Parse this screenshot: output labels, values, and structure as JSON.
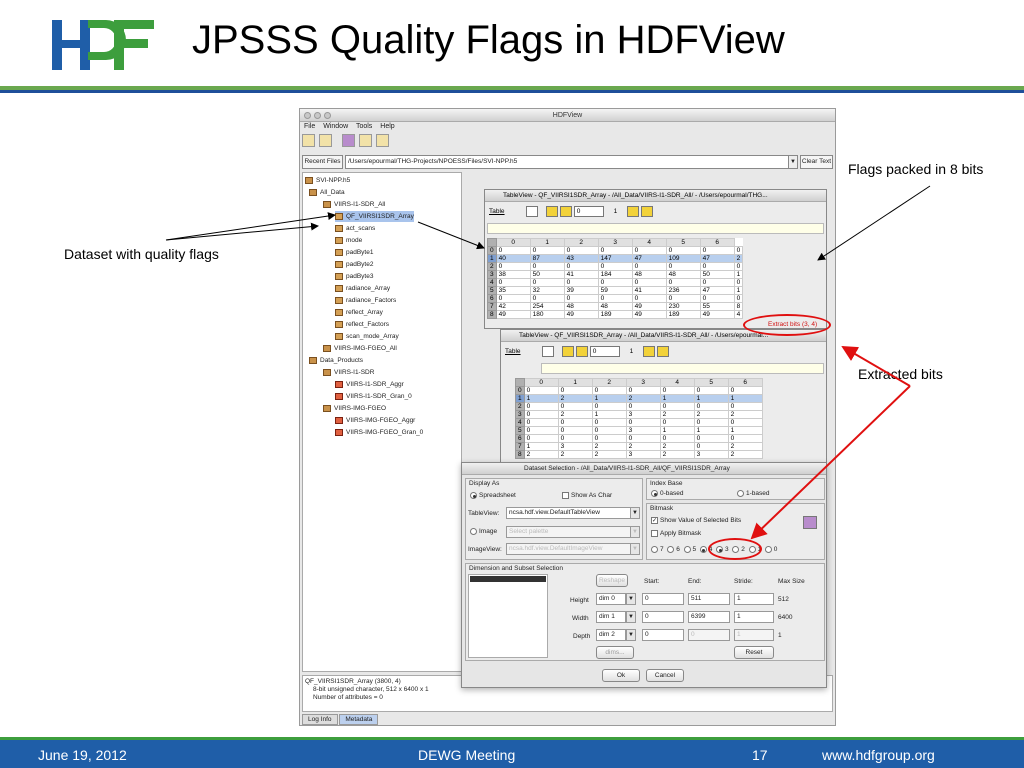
{
  "slide": {
    "title": "JPSSS Quality Flags in HDFView",
    "logo_text": "HDF",
    "callouts": {
      "flags_packed": "Flags packed in 8 bits",
      "dataset_with_flags": "Dataset with quality flags",
      "extracted_bits": "Extracted bits"
    },
    "footer": {
      "date": "June 19, 2012",
      "event": "DEWG Meeting",
      "page": "17",
      "url": "www.hdfgroup.org"
    },
    "colors": {
      "green": "#3d9e3d",
      "blue": "#1f5ea8",
      "annotation": "#e01010"
    }
  },
  "hdfview": {
    "window_title": "HDFView",
    "menu": [
      "File",
      "Window",
      "Tools",
      "Help"
    ],
    "recent_files_label": "Recent Files",
    "recent_path": "/Users/epourmal/THG-Projects/NPOESS/Files/SVI-NPP.h5",
    "clear_text_label": "Clear Text",
    "tree": [
      {
        "label": "SVI-NPP.h5",
        "icon": "file-icon"
      },
      {
        "label": "All_Data",
        "icon": "folder-icon"
      },
      {
        "label": "VIIRS-I1-SDR_All",
        "icon": "folder-icon"
      },
      {
        "label": "QF_VIIRSI1SDR_Array",
        "icon": "dataset-icon"
      },
      {
        "label": "act_scans",
        "icon": "dataset-icon"
      },
      {
        "label": "mode",
        "icon": "dataset-icon"
      },
      {
        "label": "padByte1",
        "icon": "dataset-icon"
      },
      {
        "label": "padByte2",
        "icon": "dataset-icon"
      },
      {
        "label": "padByte3",
        "icon": "dataset-icon"
      },
      {
        "label": "radiance_Array",
        "icon": "dataset-icon"
      },
      {
        "label": "radiance_Factors",
        "icon": "dataset-icon"
      },
      {
        "label": "reflect_Array",
        "icon": "dataset-icon"
      },
      {
        "label": "reflect_Factors",
        "icon": "dataset-icon"
      },
      {
        "label": "scan_mode_Array",
        "icon": "dataset-icon"
      },
      {
        "label": "VIIRS-IMG-FGEO_All",
        "icon": "folder-icon"
      },
      {
        "label": "Data_Products",
        "icon": "folder-icon"
      },
      {
        "label": "VIIRS-I1-SDR",
        "icon": "folder-icon"
      },
      {
        "label": "VIIRS-I1-SDR_Aggr",
        "icon": "image-icon"
      },
      {
        "label": "VIIRS-I1-SDR_Gran_0",
        "icon": "image-icon"
      },
      {
        "label": "VIIRS-IMG-FGEO",
        "icon": "folder-icon"
      },
      {
        "label": "VIIRS-IMG-FGEO_Aggr",
        "icon": "image-icon"
      },
      {
        "label": "VIIRS-IMG-FGEO_Gran_0",
        "icon": "image-icon"
      }
    ],
    "info_lines": [
      "QF_VIIRSI1SDR_Array (3800, 4)",
      "8-bit unsigned character,    512 x 6400 x 1",
      "Number of attributes = 0"
    ],
    "bottom_tabs": [
      "Log Info",
      "Metadata"
    ]
  },
  "table1": {
    "title": "TableView - QF_VIIRSI1SDR_Array - /All_Data/VIIRS-I1-SDR_All/ - /Users/epourmal/THG...",
    "table_menu": "Table",
    "page_value": "0",
    "page_total": "1",
    "columns": [
      "0",
      "1",
      "2",
      "3",
      "4",
      "5",
      "6"
    ],
    "rows": [
      [
        "0",
        "0",
        "0",
        "0",
        "0",
        "0",
        "0",
        "0"
      ],
      [
        "1",
        "40",
        "87",
        "43",
        "147",
        "47",
        "109",
        "47"
      ],
      [
        "2",
        "0",
        "0",
        "0",
        "0",
        "0",
        "0",
        "0"
      ],
      [
        "3",
        "38",
        "50",
        "41",
        "184",
        "48",
        "48",
        "50"
      ],
      [
        "4",
        "0",
        "0",
        "0",
        "0",
        "0",
        "0",
        "0"
      ],
      [
        "5",
        "35",
        "32",
        "39",
        "59",
        "41",
        "236",
        "47"
      ],
      [
        "6",
        "0",
        "0",
        "0",
        "0",
        "0",
        "0",
        "0"
      ],
      [
        "7",
        "42",
        "254",
        "48",
        "48",
        "49",
        "230",
        "55"
      ],
      [
        "8",
        "49",
        "180",
        "49",
        "189",
        "49",
        "189",
        "49"
      ]
    ],
    "last_col_partial": [
      "0",
      "2",
      "0",
      "1",
      "0",
      "1",
      "0",
      "8",
      "4"
    ]
  },
  "table2": {
    "title": "TableView - QF_VIIRSI1SDR_Array - /All_Data/VIIRS-I1-SDR_All/ - /Users/epourmal...",
    "extract_label": "Extract bits (3, 4)",
    "table_menu": "Table",
    "page_value": "0",
    "page_total": "1",
    "columns": [
      "0",
      "1",
      "2",
      "3",
      "4",
      "5",
      "6"
    ],
    "rows": [
      [
        "0",
        "0",
        "0",
        "0",
        "0",
        "0",
        "0",
        "0"
      ],
      [
        "1",
        "1",
        "2",
        "1",
        "2",
        "1",
        "1",
        "1"
      ],
      [
        "2",
        "0",
        "0",
        "0",
        "0",
        "0",
        "0",
        "0"
      ],
      [
        "3",
        "0",
        "2",
        "1",
        "3",
        "2",
        "2",
        "2"
      ],
      [
        "4",
        "0",
        "0",
        "0",
        "0",
        "0",
        "0",
        "0"
      ],
      [
        "5",
        "0",
        "0",
        "0",
        "3",
        "1",
        "1",
        "1"
      ],
      [
        "6",
        "0",
        "0",
        "0",
        "0",
        "0",
        "0",
        "0"
      ],
      [
        "7",
        "1",
        "3",
        "2",
        "2",
        "2",
        "0",
        "2"
      ],
      [
        "8",
        "2",
        "2",
        "2",
        "3",
        "2",
        "3",
        "2"
      ]
    ]
  },
  "dialog": {
    "title": "Dataset Selection - /All_Data/VIIRS-I1-SDR_All/QF_VIIRSI1SDR_Array",
    "display_as": "Display As",
    "spreadsheet": "Spreadsheet",
    "show_as_char": "Show As Char",
    "tableview_label": "TableView:",
    "tableview_value": "ncsa.hdf.view.DefaultTableView",
    "image_label": "Image",
    "select_palette": "Select palette",
    "imageview_label": "ImageView:",
    "imageview_value": "ncsa.hdf.view.DefaultImageView",
    "index_base": "Index Base",
    "zero_based": "0-based",
    "one_based": "1-based",
    "bitmask": "Bitmask",
    "show_value": "Show Value of Selected Bits",
    "apply_bitmask": "Apply Bitmask",
    "bits": [
      "7",
      "6",
      "5",
      "4",
      "3",
      "2",
      "1",
      "0"
    ],
    "bits_selected": [
      "4",
      "3"
    ],
    "dimension_title": "Dimension and Subset Selection",
    "reshape": "Reshape",
    "start": "Start:",
    "end": "End:",
    "stride": "Stride:",
    "max_size": "Max Size",
    "dims": [
      {
        "name": "Height",
        "dim": "dim 0",
        "start": "0",
        "end": "511",
        "stride": "1",
        "max": "512"
      },
      {
        "name": "Width",
        "dim": "dim 1",
        "start": "0",
        "end": "6399",
        "stride": "1",
        "max": "6400"
      },
      {
        "name": "Depth",
        "dim": "dim 2",
        "start": "0",
        "end": "0",
        "stride": "1",
        "max": "1"
      }
    ],
    "dims_button": "dims...",
    "reset_button": "Reset",
    "ok_button": "Ok",
    "cancel_button": "Cancel"
  }
}
